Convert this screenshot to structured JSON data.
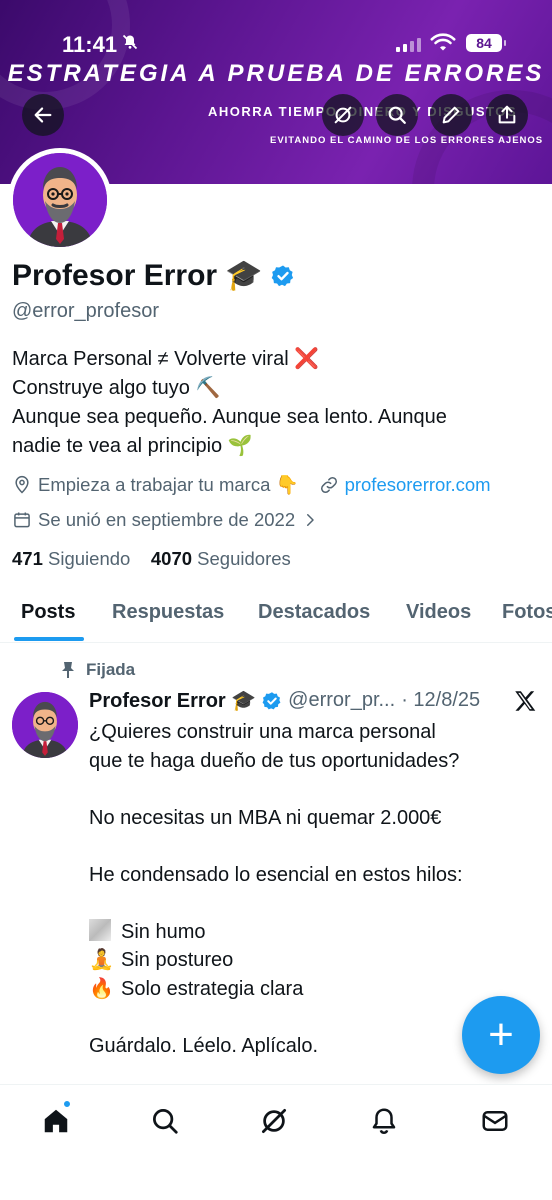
{
  "status_bar": {
    "time": "11:41",
    "battery": "84"
  },
  "banner": {
    "title": "ESTRATEGIA A PRUEBA DE ERRORES",
    "subtitle": "AHORRA TIEMPO, DINERO Y DISGUSTOS",
    "tagline": "EVITANDO EL CAMINO DE LOS ERRORES AJENOS"
  },
  "profile": {
    "name": "Profesor Error 🎓",
    "handle": "@error_profesor",
    "bio": [
      "Marca Personal ≠ Volverte viral ❌",
      "Construye algo tuyo ⛏️",
      "Aunque sea pequeño. Aunque sea lento. Aunque",
      "nadie te vea al principio 🌱"
    ],
    "location": "Empieza a trabajar tu marca 👇",
    "website": "profesorerror.com",
    "joined": "Se unió en septiembre de 2022",
    "following_count": "471",
    "following_label": "Siguiendo",
    "followers_count": "4070",
    "followers_label": "Seguidores"
  },
  "tabs": [
    "Posts",
    "Respuestas",
    "Destacados",
    "Videos",
    "Fotos"
  ],
  "post": {
    "pinned_label": "Fijada",
    "author": "Profesor Error 🎓",
    "handle": "@error_pr...",
    "date": "· 12/8/25",
    "lines": [
      "¿Quieres construir una marca personal",
      "que te haga dueño de tus oportunidades?",
      "",
      "No necesitas un MBA ni quemar 2.000€",
      "",
      "He condensado lo esencial en estos hilos:",
      ""
    ],
    "list": [
      {
        "icon": "",
        "text": "Sin humo"
      },
      {
        "icon": "🧘",
        "text": "Sin postureo"
      },
      {
        "icon": "🔥",
        "text": "Solo estrategia clara"
      }
    ],
    "closing": "Guárdalo. Léelo. Aplícalo."
  },
  "fab_label": "+",
  "colors": {
    "accent": "#1d9bf0",
    "banner": "#5b1590",
    "avatar_bg": "#7c1fc9"
  }
}
